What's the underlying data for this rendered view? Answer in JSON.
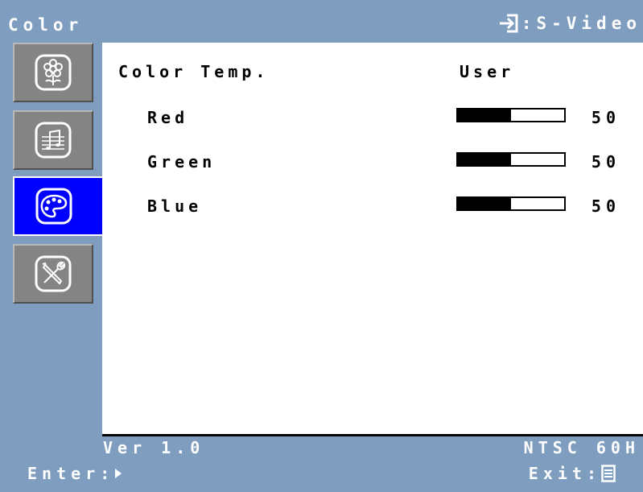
{
  "header": {
    "title": "Color",
    "source_label": ":S-Video"
  },
  "tabs": [
    {
      "icon": "flower-icon",
      "active": false
    },
    {
      "icon": "music-note-icon",
      "active": false
    },
    {
      "icon": "palette-icon",
      "active": true
    },
    {
      "icon": "tools-icon",
      "active": false
    }
  ],
  "panel": {
    "color_temp": {
      "label": "Color Temp.",
      "value": "User"
    },
    "channels": [
      {
        "label": "Red",
        "value": "50",
        "level": 0.5
      },
      {
        "label": "Green",
        "value": "50",
        "level": 0.5
      },
      {
        "label": "Blue",
        "value": "50",
        "level": 0.5
      }
    ]
  },
  "footer": {
    "version": "Ver 1.0",
    "signal": "NTSC 60H",
    "enter_label": "Enter:",
    "exit_label": "Exit:"
  },
  "colors": {
    "background": "#7f9dbf",
    "active_tab": "#0000ff",
    "tab": "#848484",
    "panel": "#ffffff"
  }
}
